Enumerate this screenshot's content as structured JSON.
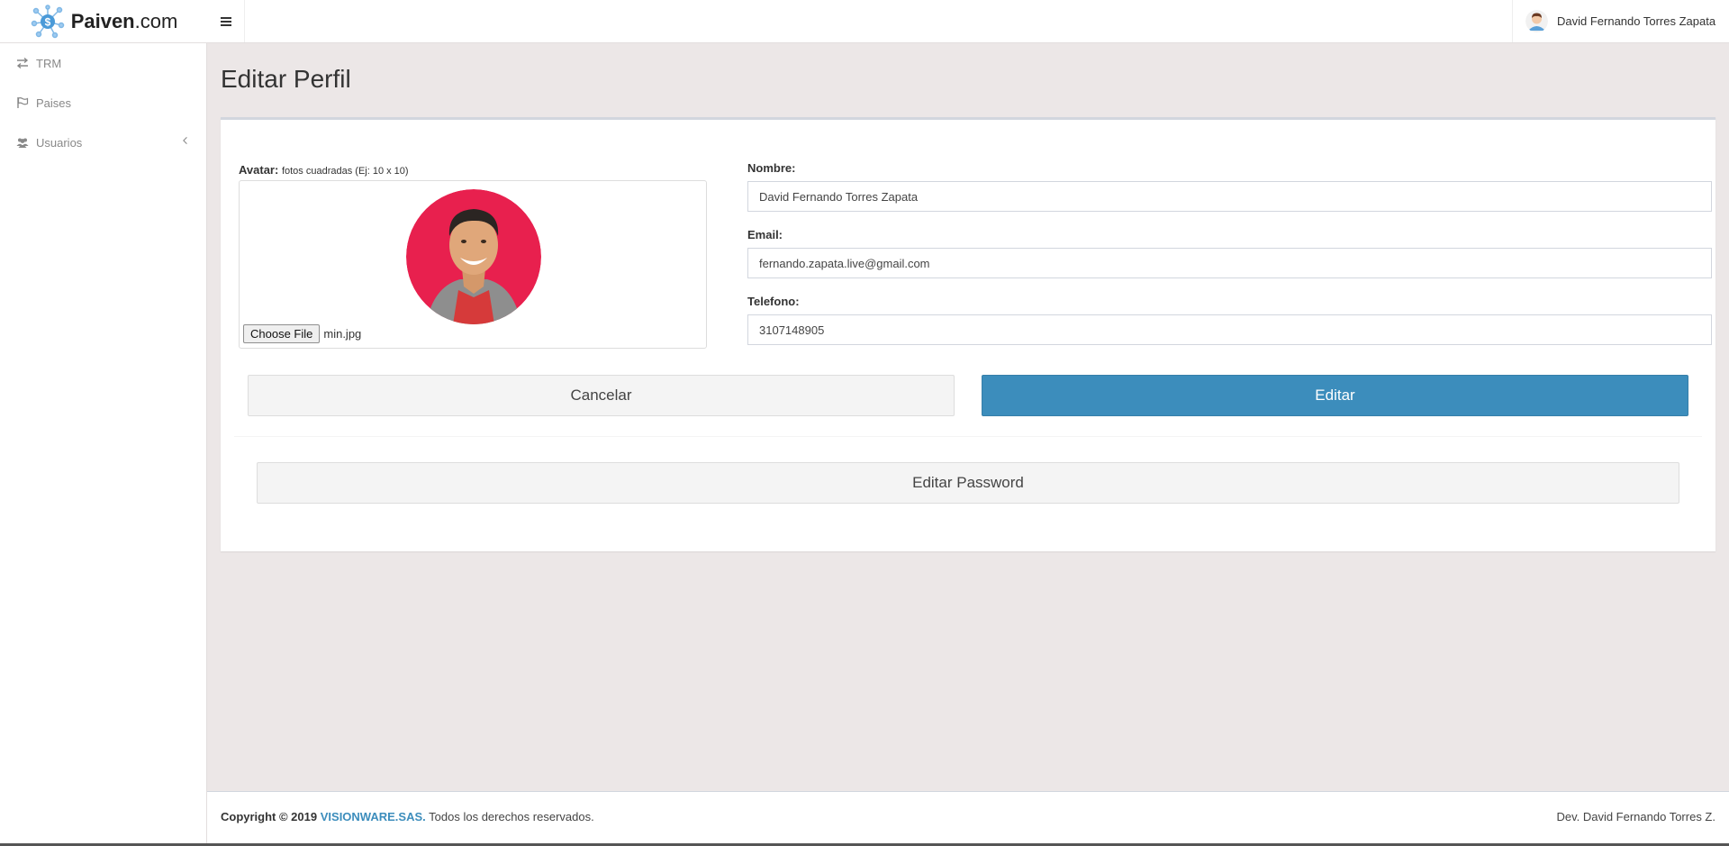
{
  "brand": {
    "name_bold": "Paiven",
    "name_rest": ".com",
    "logo_icon": "network-dollar-icon"
  },
  "header": {
    "menu_icon": "hamburger-icon",
    "user_name": "David Fernando Torres Zapata"
  },
  "sidebar": {
    "items": [
      {
        "label": "TRM",
        "icon": "exchange-icon"
      },
      {
        "label": "Paises",
        "icon": "flag-icon"
      },
      {
        "label": "Usuarios",
        "icon": "users-icon",
        "expand_icon": "chevron-left-icon"
      }
    ]
  },
  "page": {
    "title": "Editar Perfil"
  },
  "form": {
    "avatar_label": "Avatar:",
    "avatar_hint": "fotos cuadradas (Ej: 10 x 10)",
    "file_button": "Choose File",
    "file_name": "min.jpg",
    "nombre_label": "Nombre:",
    "nombre_value": "David Fernando Torres Zapata",
    "email_label": "Email:",
    "email_value": "fernando.zapata.live@gmail.com",
    "telefono_label": "Telefono:",
    "telefono_value": "3107148905",
    "cancel_button": "Cancelar",
    "submit_button": "Editar",
    "password_button": "Editar Password"
  },
  "footer": {
    "copyright": "Copyright © 2019",
    "company": "VISIONWARE.SAS.",
    "rights": "Todos los derechos reservados.",
    "dev": "Dev. David Fernando Torres Z."
  },
  "colors": {
    "primary": "#3c8dbc",
    "background": "#ece7e7",
    "avatar_bg": "#e8204e"
  }
}
